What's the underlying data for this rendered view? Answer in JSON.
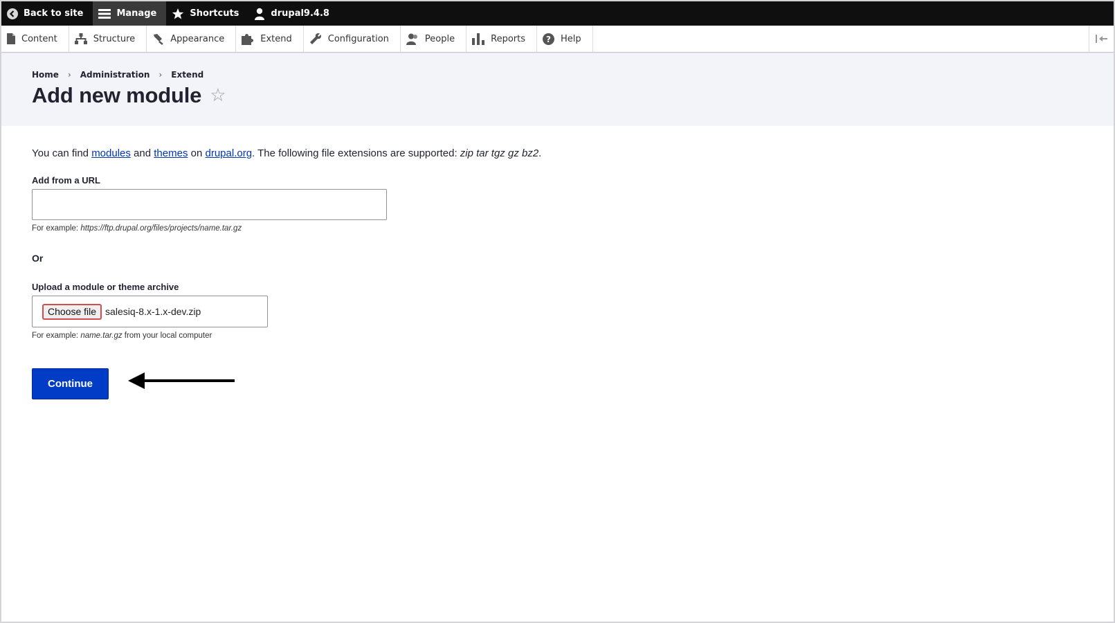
{
  "toolbar": {
    "back_label": "Back to site",
    "manage_label": "Manage",
    "shortcuts_label": "Shortcuts",
    "user_label": "drupal9.4.8"
  },
  "tray": {
    "items": [
      {
        "label": "Content",
        "icon": "file-icon"
      },
      {
        "label": "Structure",
        "icon": "sitemap-icon"
      },
      {
        "label": "Appearance",
        "icon": "paintbrush-icon"
      },
      {
        "label": "Extend",
        "icon": "puzzle-icon"
      },
      {
        "label": "Configuration",
        "icon": "wrench-icon"
      },
      {
        "label": "People",
        "icon": "people-icon"
      },
      {
        "label": "Reports",
        "icon": "bar-chart-icon"
      },
      {
        "label": "Help",
        "icon": "question-icon"
      }
    ]
  },
  "breadcrumb": {
    "items": [
      "Home",
      "Administration",
      "Extend"
    ],
    "separator": "›"
  },
  "page": {
    "title": "Add new module",
    "star": "☆"
  },
  "intro": {
    "prefix": "You can find ",
    "link_modules": "modules",
    "and": " and ",
    "link_themes": "themes",
    "on": " on ",
    "link_drupal": "drupal.org",
    "suffix": ". The following file extensions are supported: ",
    "extensions": "zip tar tgz gz bz2",
    "end": "."
  },
  "url_field": {
    "label": "Add from a URL",
    "value": "",
    "help_prefix": "For example: ",
    "help_example": "https://ftp.drupal.org/files/projects/name.tar.gz"
  },
  "or_label": "Or",
  "upload_field": {
    "label": "Upload a module or theme archive",
    "button_label": "Choose file",
    "file_name": "salesiq-8.x-1.x-dev.zip",
    "help_prefix": "For example: ",
    "help_example": "name.tar.gz",
    "help_suffix": " from your local computer"
  },
  "continue_label": "Continue",
  "colors": {
    "toolbar_bg": "#0f0f0f",
    "primary_button": "#003cc5",
    "link": "#0036b1",
    "header_bg": "#f3f4f9"
  }
}
